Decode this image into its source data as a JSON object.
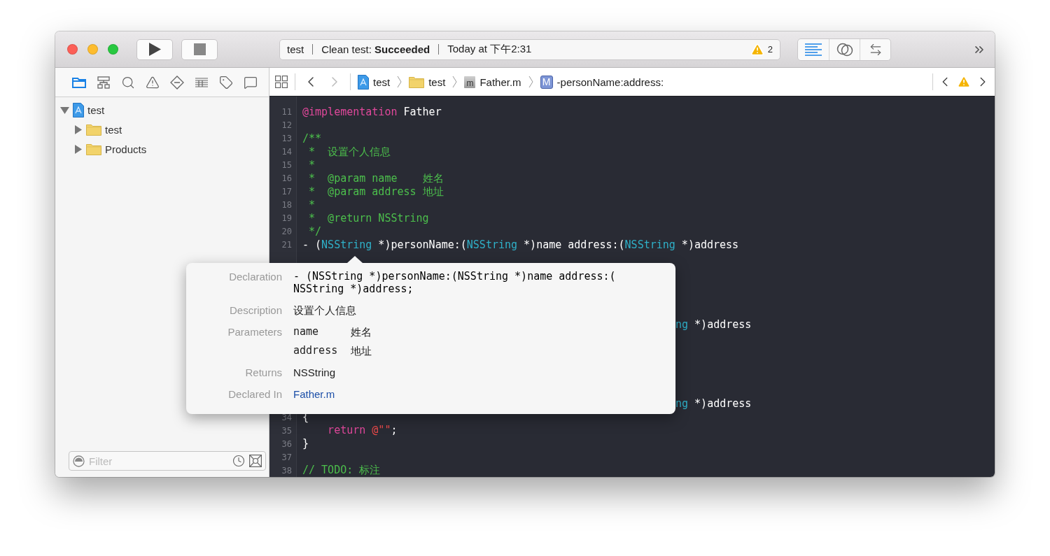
{
  "toolbar": {
    "scheme": "test",
    "status": "Clean test: **Succeeded**",
    "time": "Today at 下午2:31",
    "warnings": "2",
    "editor_modes": [
      {
        "kind": "standard",
        "selected": true
      },
      {
        "kind": "assistant",
        "selected": false
      },
      {
        "kind": "version",
        "selected": false
      }
    ]
  },
  "navigator": {
    "tabs": [
      {
        "kind": "project",
        "selected": true
      },
      {
        "kind": "symbol",
        "selected": false
      },
      {
        "kind": "find",
        "selected": false
      },
      {
        "kind": "issue",
        "selected": false
      },
      {
        "kind": "test",
        "selected": false
      },
      {
        "kind": "debug",
        "selected": false
      },
      {
        "kind": "breakpoint",
        "selected": false
      },
      {
        "kind": "report",
        "selected": false
      }
    ],
    "tree": [
      {
        "label": "test",
        "kind": "project",
        "expanded": true,
        "children": [
          {
            "label": "test",
            "kind": "folder",
            "expanded": false
          },
          {
            "label": "Products",
            "kind": "folder",
            "expanded": false
          }
        ]
      }
    ],
    "filter": {
      "placeholder": "Filter"
    }
  },
  "jump_bar": {
    "back": {
      "disabled": false
    },
    "forward": {
      "disabled": true
    },
    "path": [
      {
        "kind": "project",
        "label": "test"
      },
      {
        "kind": "folder",
        "label": "test"
      },
      {
        "kind": "file",
        "icon_letter": "m",
        "label": "Father.m"
      },
      {
        "kind": "method",
        "icon_letter": "M",
        "label": "-personName:address:"
      }
    ]
  },
  "editor": {
    "lines": [
      {
        "kind": "code",
        "number": "11",
        "tokens": [
          {
            "kind": "keyword",
            "text": "@implementation"
          },
          {
            "kind": "plain",
            "text": " Father"
          }
        ]
      },
      {
        "kind": "code",
        "number": "12"
      },
      {
        "kind": "code",
        "number": "13",
        "tokens": [
          {
            "kind": "comment",
            "text": "/**"
          }
        ]
      },
      {
        "kind": "code",
        "number": "14",
        "tokens": [
          {
            "kind": "comment",
            "text": " *  设置个人信息"
          }
        ]
      },
      {
        "kind": "code",
        "number": "15",
        "tokens": [
          {
            "kind": "comment",
            "text": " *"
          }
        ]
      },
      {
        "kind": "code",
        "number": "16",
        "tokens": [
          {
            "kind": "comment",
            "text": " *  @param name    姓名"
          }
        ]
      },
      {
        "kind": "code",
        "number": "17",
        "tokens": [
          {
            "kind": "comment",
            "text": " *  @param address 地址"
          }
        ]
      },
      {
        "kind": "code",
        "number": "18",
        "tokens": [
          {
            "kind": "comment",
            "text": " *"
          }
        ]
      },
      {
        "kind": "code",
        "number": "19",
        "tokens": [
          {
            "kind": "comment",
            "text": " *  @return NSString"
          }
        ]
      },
      {
        "kind": "code",
        "number": "20",
        "tokens": [
          {
            "kind": "comment",
            "text": " */"
          }
        ]
      },
      {
        "kind": "code",
        "number": "21",
        "tokens": [
          {
            "kind": "plain",
            "text": "- ("
          },
          {
            "kind": "type",
            "text": "NSString"
          },
          {
            "kind": "plain",
            "text": " *)personName:("
          },
          {
            "kind": "type",
            "text": "NSString"
          },
          {
            "kind": "plain",
            "text": " *)name address:("
          },
          {
            "kind": "type",
            "text": "NSString"
          },
          {
            "kind": "plain",
            "text": " *)address"
          }
        ]
      },
      {
        "kind": "covered"
      },
      {
        "kind": "covered"
      },
      {
        "kind": "covered"
      },
      {
        "kind": "covered"
      },
      {
        "kind": "covered"
      },
      {
        "kind": "tail",
        "tokens": [
          {
            "kind": "type",
            "text": "ng"
          },
          {
            "kind": "plain",
            "text": " *)address"
          }
        ]
      },
      {
        "kind": "covered"
      },
      {
        "kind": "covered"
      },
      {
        "kind": "covered"
      },
      {
        "kind": "covered"
      },
      {
        "kind": "covered"
      },
      {
        "kind": "tail",
        "tokens": [
          {
            "kind": "type",
            "text": "ng"
          },
          {
            "kind": "plain",
            "text": " *)address"
          }
        ]
      },
      {
        "kind": "code",
        "number": "34",
        "tokens": [
          {
            "kind": "plain",
            "text": "{"
          }
        ]
      },
      {
        "kind": "code",
        "number": "35",
        "tokens": [
          {
            "kind": "keyword",
            "text": "    return"
          },
          {
            "kind": "string",
            "text": " @\"\""
          },
          {
            "kind": "plain",
            "text": ";"
          }
        ]
      },
      {
        "kind": "code",
        "number": "36",
        "tokens": [
          {
            "kind": "plain",
            "text": "}"
          }
        ]
      },
      {
        "kind": "code",
        "number": "37"
      },
      {
        "kind": "code",
        "number": "38",
        "tokens": [
          {
            "kind": "comment",
            "text": "// TODO: 标注"
          }
        ]
      }
    ]
  },
  "quick_help": {
    "rows": [
      {
        "label": "Declaration",
        "kind": "code",
        "lines": [
          "- (NSString *)personName:(NSString *)name address:(",
          "NSString *)address;"
        ]
      },
      {
        "label": "Description",
        "kind": "text",
        "text": "设置个人信息"
      },
      {
        "label": "Parameters",
        "kind": "params",
        "params": [
          {
            "name": "name",
            "text": "姓名"
          },
          {
            "name": "address",
            "text": "地址"
          }
        ]
      },
      {
        "label": "Returns",
        "kind": "text",
        "text": "NSString"
      },
      {
        "label": "Declared In",
        "kind": "link",
        "text": "Father.m"
      }
    ]
  }
}
